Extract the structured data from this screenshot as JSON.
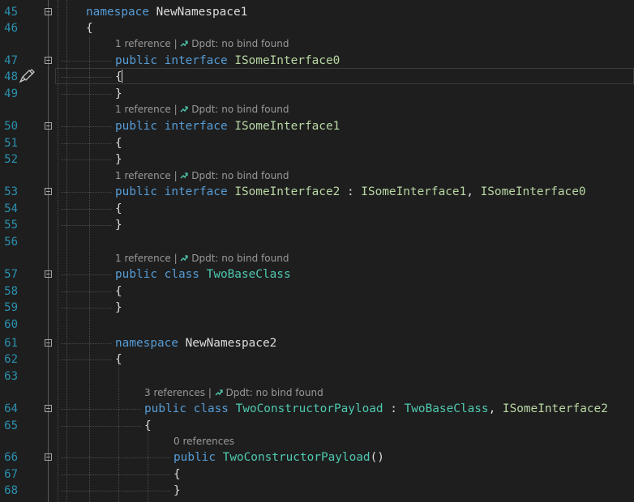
{
  "editor": {
    "lines": [
      {
        "n": "45",
        "tokens": [
          [
            "kw",
            "namespace"
          ],
          [
            "pn",
            " NewNamespace1"
          ]
        ]
      },
      {
        "n": "46",
        "tokens": [
          [
            "pn",
            "{"
          ]
        ]
      },
      {
        "n": "47",
        "tokens": [
          [
            "kw",
            "public"
          ],
          [
            "pn",
            " "
          ],
          [
            "kw",
            "interface"
          ],
          [
            "pn",
            " "
          ],
          [
            "in",
            "ISomeInterface0"
          ]
        ]
      },
      {
        "n": "48",
        "tokens": [
          [
            "pn",
            "{"
          ]
        ]
      },
      {
        "n": "49",
        "tokens": [
          [
            "pn",
            "}"
          ]
        ]
      },
      {
        "n": "50",
        "tokens": [
          [
            "kw",
            "public"
          ],
          [
            "pn",
            " "
          ],
          [
            "kw",
            "interface"
          ],
          [
            "pn",
            " "
          ],
          [
            "in",
            "ISomeInterface1"
          ]
        ]
      },
      {
        "n": "51",
        "tokens": [
          [
            "pn",
            "{"
          ]
        ]
      },
      {
        "n": "52",
        "tokens": [
          [
            "pn",
            "}"
          ]
        ]
      },
      {
        "n": "53",
        "tokens": [
          [
            "kw",
            "public"
          ],
          [
            "pn",
            " "
          ],
          [
            "kw",
            "interface"
          ],
          [
            "pn",
            " "
          ],
          [
            "in",
            "ISomeInterface2"
          ],
          [
            "pn",
            " : "
          ],
          [
            "in",
            "ISomeInterface1"
          ],
          [
            "pn",
            ", "
          ],
          [
            "in",
            "ISomeInterface0"
          ]
        ]
      },
      {
        "n": "54",
        "tokens": [
          [
            "pn",
            "{"
          ]
        ]
      },
      {
        "n": "55",
        "tokens": [
          [
            "pn",
            "}"
          ]
        ]
      },
      {
        "n": "56",
        "tokens": []
      },
      {
        "n": "57",
        "tokens": [
          [
            "kw",
            "public"
          ],
          [
            "pn",
            " "
          ],
          [
            "kw",
            "class"
          ],
          [
            "pn",
            " "
          ],
          [
            "ty",
            "TwoBaseClass"
          ]
        ]
      },
      {
        "n": "58",
        "tokens": [
          [
            "pn",
            "{"
          ]
        ]
      },
      {
        "n": "59",
        "tokens": [
          [
            "pn",
            "}"
          ]
        ]
      },
      {
        "n": "60",
        "tokens": []
      },
      {
        "n": "61",
        "tokens": [
          [
            "kw",
            "namespace"
          ],
          [
            "pn",
            " NewNamespace2"
          ]
        ]
      },
      {
        "n": "62",
        "tokens": [
          [
            "pn",
            "{"
          ]
        ]
      },
      {
        "n": "63",
        "tokens": []
      },
      {
        "n": "64",
        "tokens": [
          [
            "kw",
            "public"
          ],
          [
            "pn",
            " "
          ],
          [
            "kw",
            "class"
          ],
          [
            "pn",
            " "
          ],
          [
            "ty",
            "TwoConstructorPayload"
          ],
          [
            "pn",
            " : "
          ],
          [
            "ty",
            "TwoBaseClass"
          ],
          [
            "pn",
            ", "
          ],
          [
            "in",
            "ISomeInterface2"
          ]
        ]
      },
      {
        "n": "65",
        "tokens": [
          [
            "pn",
            "{"
          ]
        ]
      },
      {
        "n": "66",
        "tokens": [
          [
            "kw",
            "public"
          ],
          [
            "pn",
            " "
          ],
          [
            "ty",
            "TwoConstructorPayload"
          ],
          [
            "pn",
            "()"
          ]
        ]
      },
      {
        "n": "67",
        "tokens": [
          [
            "pn",
            "{"
          ]
        ]
      },
      {
        "n": "68",
        "tokens": [
          [
            "pn",
            "}"
          ]
        ]
      }
    ],
    "lenses": [
      {
        "refs": "1 reference",
        "sep": " | ",
        "bind": "Dpdt: no bind found"
      },
      {
        "refs": "1 reference",
        "sep": " | ",
        "bind": "Dpdt: no bind found"
      },
      {
        "refs": "1 reference",
        "sep": " | ",
        "bind": "Dpdt: no bind found"
      },
      {
        "refs": "1 reference",
        "sep": " | ",
        "bind": "Dpdt: no bind found"
      },
      {
        "refs": "3 references",
        "sep": " | ",
        "bind": "Dpdt: no bind found"
      },
      {
        "refs": "0 references",
        "sep": "",
        "bind": ""
      }
    ],
    "current_line": "48",
    "margin_icon": "paintbrush-icon",
    "fold_icon": "collapse-minus-icon",
    "bind_icon": "dependency-arrow-icon"
  },
  "colors": {
    "background": "#1e1e1e",
    "keyword": "#569cd6",
    "type": "#4ec9b0",
    "interface": "#b8d7a3",
    "plain": "#dcdcdc",
    "line_number": "#2b91af",
    "codelens": "#999999"
  }
}
